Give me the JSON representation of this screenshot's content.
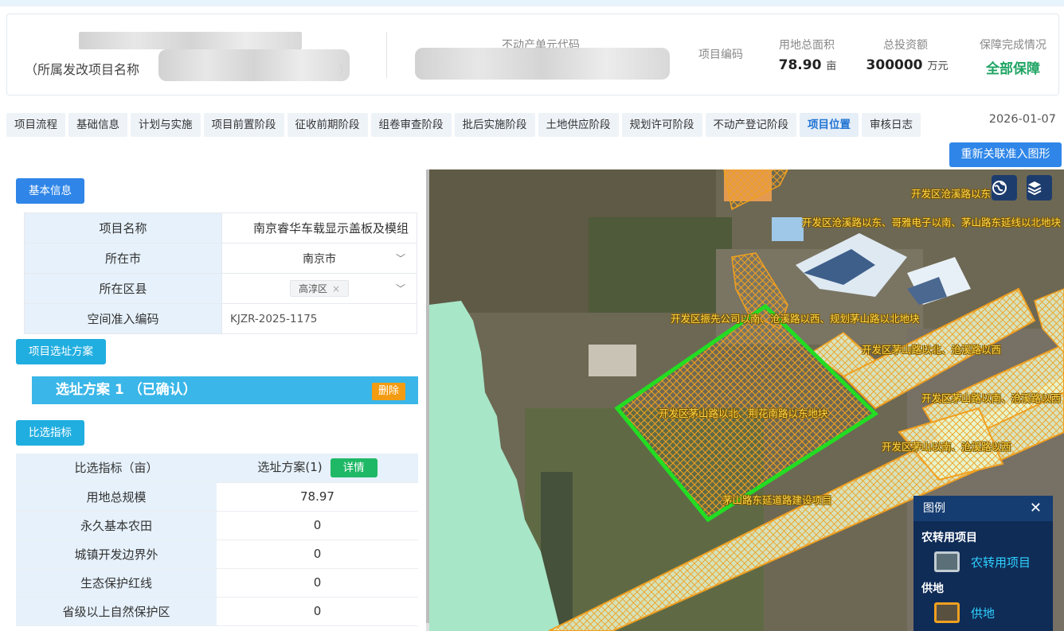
{
  "header": {
    "project_name_prefix": "（所属发改项目名称",
    "project_name_suffix": "）",
    "unit_code_label": "不动产单元代码",
    "project_code_label": "项目编码",
    "area_label": "用地总面积",
    "area_value": "78.90",
    "area_unit": "亩",
    "invest_label": "总投资额",
    "invest_value": "300000",
    "invest_unit": "万元",
    "guarantee_label": "保障完成情况",
    "guarantee_value": "全部保障"
  },
  "tabs": [
    "项目流程",
    "基础信息",
    "计划与实施",
    "项目前置阶段",
    "征收前期阶段",
    "组卷审查阶段",
    "批后实施阶段",
    "土地供应阶段",
    "规划许可阶段",
    "不动产登记阶段",
    "项目位置",
    "审核日志"
  ],
  "active_tab": "项目位置",
  "date": "2026-01-07",
  "relink_button": "重新关联准入图形",
  "basic": {
    "section_label": "基本信息",
    "rows": [
      {
        "label": "项目名称",
        "value": "南京睿华车载显示盖板及模组"
      },
      {
        "label": "所在市",
        "value": "南京市"
      },
      {
        "label": "所在区县",
        "value": "高淳区"
      },
      {
        "label": "空间准入编码",
        "value": "KJZR-2025-1175"
      }
    ]
  },
  "site": {
    "section_label": "项目选址方案",
    "scheme_title": "选址方案 1 （已确认）",
    "delete_label": "删除"
  },
  "indicators": {
    "section_label": "比选指标",
    "header_label": "比选指标（亩）",
    "header_scheme": "选址方案(1)",
    "detail_label": "详情",
    "rows": [
      {
        "label": "用地总规模",
        "value": "78.97"
      },
      {
        "label": "永久基本农田",
        "value": "0"
      },
      {
        "label": "城镇开发边界外",
        "value": "0"
      },
      {
        "label": "生态保护红线",
        "value": "0"
      },
      {
        "label": "省级以上自然保护区",
        "value": "0"
      }
    ]
  },
  "map": {
    "labels": [
      "开发区沧溪路以东",
      "开发区沧溪路以东、哥雅电子以南、茅山路东延线以北地块",
      "开发区振先公司以南、沧溪路以西、规划茅山路以北地块",
      "开发区茅山路以北、沧溪路以西",
      "开发区茅山路以南、沧溪路以西",
      "开发区茅山路以北、荆花南路以东地块",
      "开发区茅山以南、沧溪路以西",
      "茅山路东延道路建设项目"
    ],
    "globe_icon": "globe-icon",
    "layers_icon": "layers-icon"
  },
  "legend": {
    "title": "图例",
    "groups": [
      {
        "group": "农转用项目",
        "item": "农转用项目",
        "color": "#c2ccd2"
      },
      {
        "group": "供地",
        "item": "供地",
        "color": "#f0a020"
      }
    ]
  },
  "colors": {
    "primary": "#2f86e8",
    "cyan": "#3ab6e8",
    "green_status": "#1fa463",
    "parcel_highlight": "#22dd22",
    "parcel_hatch": "#f0a020"
  }
}
